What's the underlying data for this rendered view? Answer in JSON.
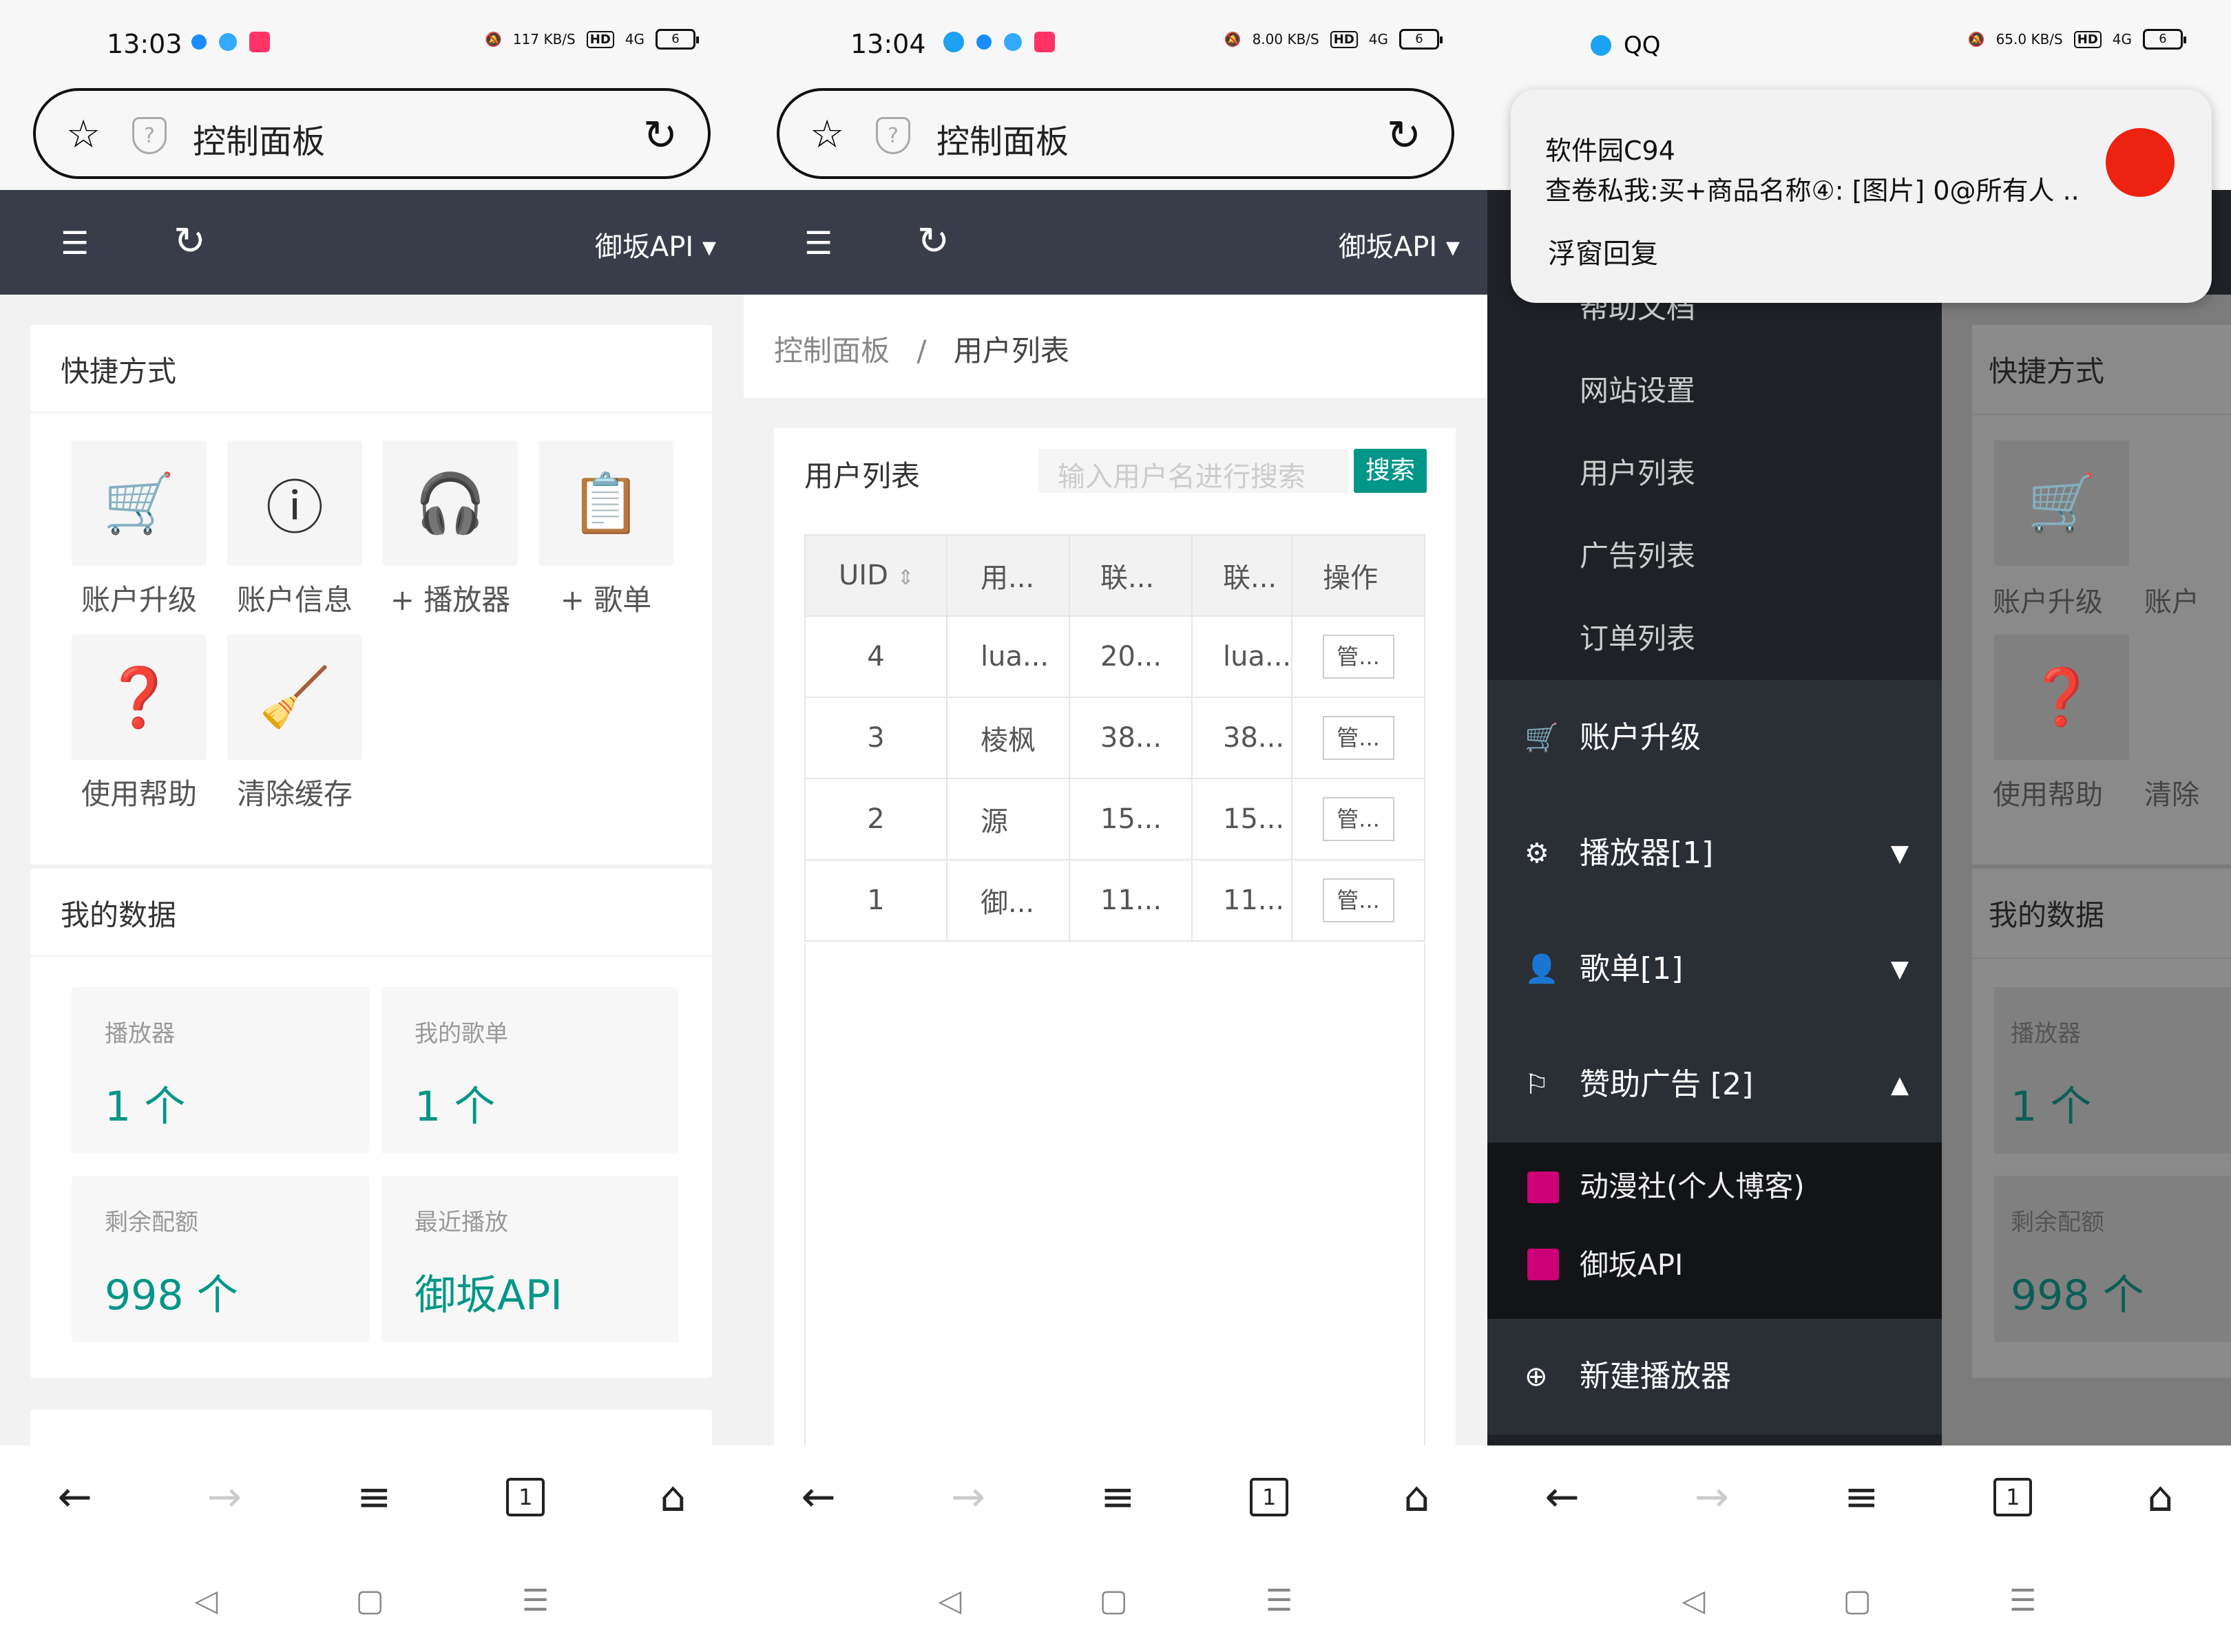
{
  "screen1": {
    "status": {
      "time": "13:03",
      "speed": "117",
      "speed_unit": "KB/S",
      "hd": "HD",
      "net": "4G",
      "battery": "6"
    },
    "url_title": "控制面板",
    "header": {
      "api_label": "御坂API"
    },
    "quick": {
      "title": "快捷方式",
      "tiles": [
        {
          "label": "账户升级",
          "icon": "cart-icon"
        },
        {
          "label": "账户信息",
          "icon": "info-icon"
        },
        {
          "label": "+ 播放器",
          "icon": "headphones-icon"
        },
        {
          "label": "+ 歌单",
          "icon": "clipboard-icon"
        },
        {
          "label": "使用帮助",
          "icon": "help-icon"
        },
        {
          "label": "清除缓存",
          "icon": "broom-icon"
        }
      ]
    },
    "mydata": {
      "title": "我的数据",
      "stats": [
        {
          "key": "播放器",
          "value": "1 个"
        },
        {
          "key": "我的歌单",
          "value": "1 个"
        },
        {
          "key": "剩余配额",
          "value": "998 个"
        },
        {
          "key": "最近播放",
          "value": "御坂API"
        }
      ]
    }
  },
  "screen2": {
    "status": {
      "time": "13:04",
      "speed": "8.00",
      "speed_unit": "KB/S",
      "hd": "HD",
      "net": "4G",
      "battery": "6"
    },
    "url_title": "控制面板",
    "header": {
      "api_label": "御坂API"
    },
    "breadcrumb": {
      "root": "控制面板",
      "sep": "/",
      "current": "用户列表"
    },
    "card_title": "用户列表",
    "search": {
      "placeholder": "输入用户名进行搜索",
      "button": "搜索"
    },
    "table": {
      "headers": [
        "UID",
        "用...",
        "联...",
        "联...",
        "操作"
      ],
      "rows": [
        [
          "4",
          "lua...",
          "20...",
          "lua...",
          "管..."
        ],
        [
          "3",
          "棱枫",
          "38...",
          "38...",
          "管..."
        ],
        [
          "2",
          "源",
          "15...",
          "15...",
          "管..."
        ],
        [
          "1",
          "御...",
          "11...",
          "11...",
          "管..."
        ]
      ]
    }
  },
  "screen3": {
    "status": {
      "app": "QQ",
      "speed": "65.0",
      "speed_unit": "KB/S",
      "hd": "HD",
      "net": "4G",
      "battery": "6"
    },
    "notification": {
      "sender": "软件园C94",
      "message": "查卷私我:买+商品名称④: [图片] 0@所有人 ..",
      "action": "浮窗回复"
    },
    "sidebar": {
      "top_items": [
        "帮助文档",
        "网站设置",
        "用户列表",
        "广告列表",
        "订单列表"
      ],
      "groups": [
        {
          "label": "账户升级",
          "icon": "cart-icon"
        },
        {
          "label": "播放器[1]",
          "icon": "gear-icon"
        },
        {
          "label": "歌单[1]",
          "icon": "user-icon"
        },
        {
          "label": "赞助广告 [2]",
          "icon": "flag-icon"
        }
      ],
      "sub_items": [
        "动漫社(个人博客)",
        "御坂API"
      ],
      "new_player": "新建播放器"
    },
    "right": {
      "quick_title": "快捷方式",
      "tiles": [
        "账户升级",
        "账户",
        "使用帮助",
        "清除"
      ],
      "mydata_title": "我的数据",
      "stats": [
        {
          "key": "播放器",
          "value": "1 个"
        },
        {
          "key": "剩余配额",
          "value": "998 个"
        }
      ]
    }
  }
}
